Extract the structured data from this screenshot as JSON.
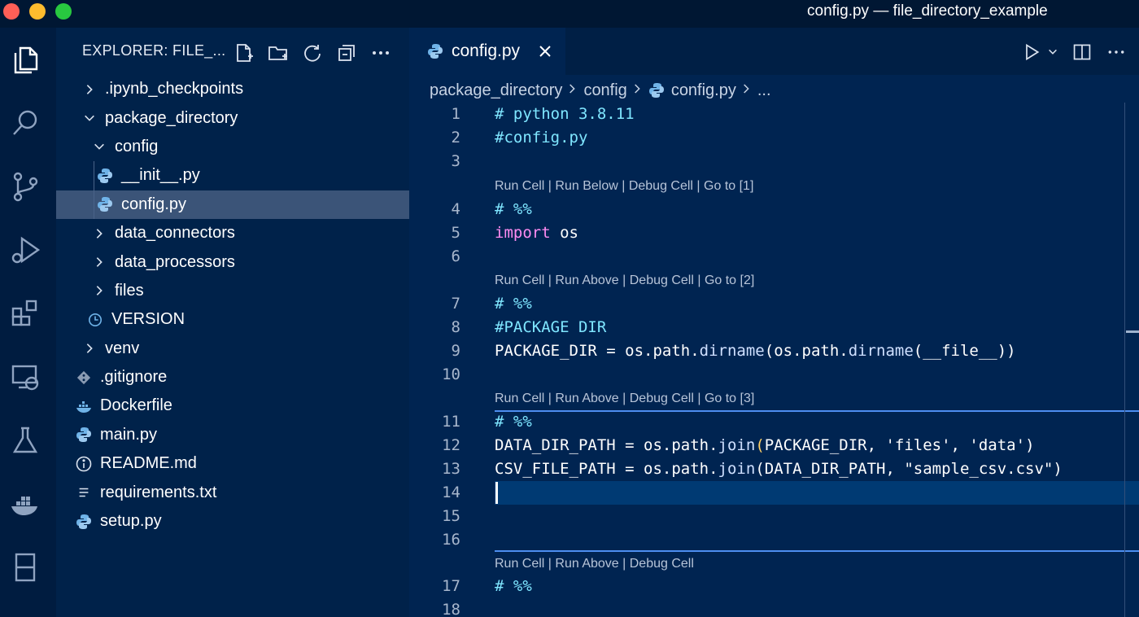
{
  "window": {
    "title": "config.py — file_directory_example"
  },
  "activity_bar": {
    "items": [
      "files-icon",
      "search-icon",
      "source-control-icon",
      "run-debug-icon",
      "extensions-icon",
      "remote-explorer-icon",
      "testing-icon",
      "docker-icon",
      "notebook-icon"
    ]
  },
  "sidebar": {
    "header": "EXPLORER: FILE_...",
    "tree": [
      {
        "label": ".ipynb_checkpoints",
        "type": "folder",
        "expanded": false
      },
      {
        "label": "package_directory",
        "type": "folder",
        "expanded": true
      },
      {
        "label": "config",
        "type": "folder",
        "expanded": true
      },
      {
        "label": "__init__.py",
        "type": "python"
      },
      {
        "label": "config.py",
        "type": "python",
        "selected": true
      },
      {
        "label": "data_connectors",
        "type": "folder",
        "expanded": false
      },
      {
        "label": "data_processors",
        "type": "folder",
        "expanded": false
      },
      {
        "label": "files",
        "type": "folder",
        "expanded": false
      },
      {
        "label": "VERSION",
        "type": "clock"
      },
      {
        "label": "venv",
        "type": "folder",
        "expanded": false
      },
      {
        "label": ".gitignore",
        "type": "git"
      },
      {
        "label": "Dockerfile",
        "type": "docker"
      },
      {
        "label": "main.py",
        "type": "python"
      },
      {
        "label": "README.md",
        "type": "info"
      },
      {
        "label": "requirements.txt",
        "type": "text"
      },
      {
        "label": "setup.py",
        "type": "python"
      }
    ]
  },
  "editor": {
    "tab_label": "config.py",
    "breadcrumb": [
      "package_directory",
      "config",
      "config.py",
      "..."
    ],
    "lens": {
      "l1": "Run Cell | Run Below | Debug Cell | Go to [1]",
      "l2": "Run Cell | Run Above | Debug Cell | Go to [2]",
      "l3": "Run Cell | Run Above | Debug Cell | Go to [3]",
      "l4": "Run Cell | Run Above | Debug Cell"
    },
    "line_numbers": [
      "1",
      "2",
      "3",
      "4",
      "5",
      "6",
      "7",
      "8",
      "9",
      "10",
      "11",
      "12",
      "13",
      "14",
      "15",
      "16",
      "17",
      "18"
    ],
    "code": {
      "c1": "# python 3.8.11",
      "c2": "#config.py",
      "c4": "# %%",
      "c5_kw": "import",
      "c5_rest": " os",
      "c7": "# %%",
      "c8": "#PACKAGE DIR",
      "c9a": "PACKAGE_DIR = os.path.",
      "c9fn": "dirname",
      "c9b": "(os.path.",
      "c9fn2": "dirname",
      "c9c": "(__file__))",
      "c11": "# %%",
      "c12a": "DATA_DIR_PATH = os.path.",
      "c12fn": "join",
      "c12p1": "(",
      "c12b": "PACKAGE_DIR, 'files', 'data'",
      "c12p2": ")",
      "c13a": "CSV_FILE_PATH = os.path.",
      "c13fn": "join",
      "c13b": "(DATA_DIR_PATH, \"sample_csv.csv\")",
      "c17": "# %%"
    }
  }
}
